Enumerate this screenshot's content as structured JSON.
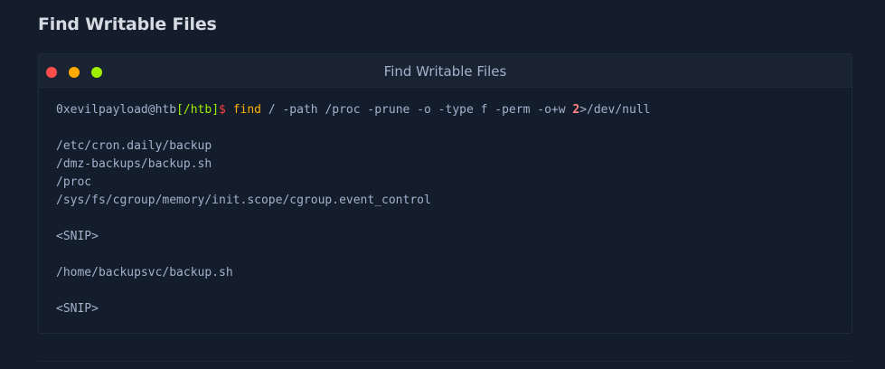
{
  "section": {
    "title": "Find Writable Files"
  },
  "terminal": {
    "window_title": "Find Writable Files",
    "prompt": {
      "user_host": "0xevilpayload@htb",
      "path": "[/htb]",
      "symbol": "$"
    },
    "command": {
      "name": "find",
      "args": " / -path /proc -prune -o -type f -perm -o+w ",
      "fd": "2",
      "redirect": ">",
      "target": "/dev/null"
    },
    "output_block_1": [
      "/etc/cron.daily/backup",
      "/dmz-backups/backup.sh",
      "/proc",
      "/sys/fs/cgroup/memory/init.scope/cgroup.event_control"
    ],
    "snip_1": "<SNIP>",
    "output_block_2": [
      "/home/backupsvc/backup.sh"
    ],
    "snip_2": "<SNIP>"
  },
  "colors": {
    "background": "#141d2b",
    "titlebar": "#1a2332",
    "traffic_red": "#ff4d4d",
    "traffic_yellow": "#ffaa00",
    "traffic_green": "#9fef00",
    "prompt_path": "#9fef00",
    "prompt_symbol": "#ff3e3e",
    "command": "#ffaf00"
  }
}
